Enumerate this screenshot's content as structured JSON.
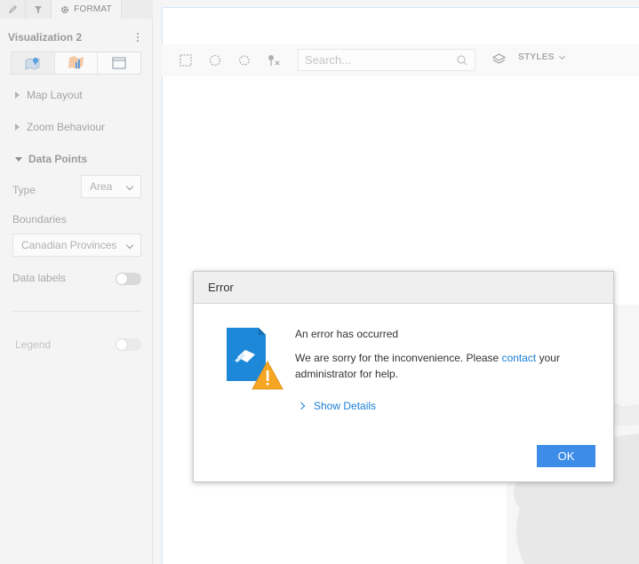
{
  "panel": {
    "tabs": {
      "format_label": "FORMAT"
    },
    "title": "Visualization 2",
    "sections": {
      "map_layout": "Map Layout",
      "zoom_behaviour": "Zoom Behaviour",
      "data_points": "Data Points"
    },
    "type": {
      "label": "Type",
      "value": "Area"
    },
    "boundaries": {
      "label": "Boundaries",
      "value": "Canadian Provinces"
    },
    "data_labels": {
      "label": "Data labels",
      "on": false
    },
    "legend": {
      "label": "Legend",
      "on": false
    }
  },
  "toolbar": {
    "search_placeholder": "Search...",
    "styles_label": "STYLES"
  },
  "dialog": {
    "title": "Error",
    "message_title": "An error has occurred",
    "message_part1": "We are sorry for the inconvenience. Please ",
    "message_link": "contact",
    "message_part2": " your administrator for help.",
    "show_details": "Show Details",
    "ok_label": "OK"
  },
  "colors": {
    "accent": "#3c8ce8",
    "link": "#1a7fd6",
    "warning": "#f5a623",
    "file_icon": "#1e88d8"
  }
}
